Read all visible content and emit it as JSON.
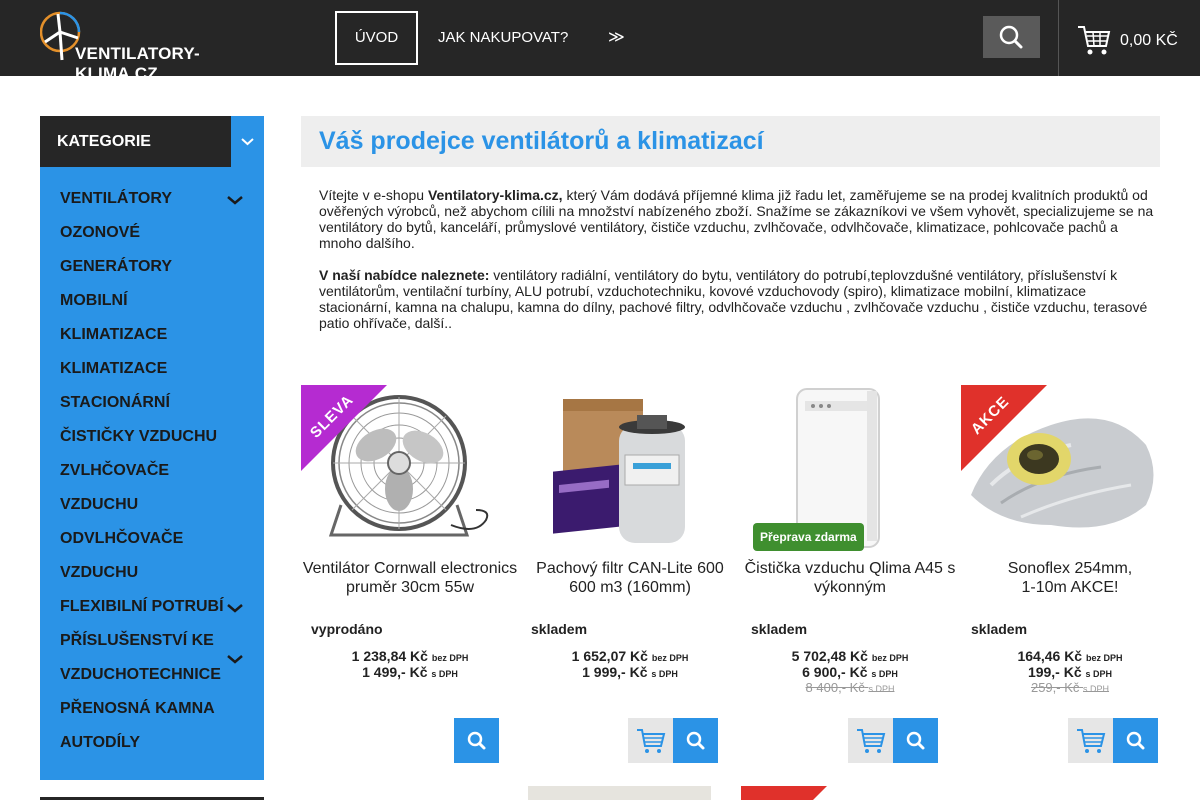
{
  "header": {
    "logo_text": "VENTILATORY-KLIMA.CZ",
    "nav": [
      "ÚVOD",
      "JAK NAKUPOVAT?",
      "≫"
    ],
    "cart_total": "0,00 KČ"
  },
  "sidebar": {
    "heading": "KATEGORIE",
    "items": [
      "VENTILÁTORY",
      "OZONOVÉ",
      "GENERÁTORY",
      "MOBILNÍ",
      "KLIMATIZACE",
      "KLIMATIZACE",
      "STACIONÁRNÍ",
      "ČISTIČKY VZDUCHU",
      "ZVLHČOVAČE",
      "VZDUCHU",
      "ODVLHČOVAČE",
      "VZDUCHU",
      "FLEXIBILNÍ POTRUBÍ",
      "PŘÍSLUŠENSTVÍ KE",
      "VZDUCHOTECHNICE",
      "PŘENOSNÁ KAMNA",
      "AUTODÍLY"
    ]
  },
  "main": {
    "title": "Váš prodejce ventilátorů a klimatizací",
    "intro_p1_pre": "Vítejte v e-shopu ",
    "intro_p1_bold": "Ventilatory-klima.cz,",
    "intro_p1_post": " který Vám dodává příjemné klima již řadu let, zaměřujeme se na prodej kvalitních produktů od ověřených výrobců, než abychom cílili na množství nabízeného zboží. Snažíme se zákazníkovi ve všem vyhovět, specializujeme se na ventilátory do bytů, kanceláří, průmyslové ventilátory, čističe vzduchu, zvlhčovače, odvlhčovače, klimatizace, pohlcovače pachů a mnoho dalšího.",
    "intro_p2_bold": "V naší nabídce naleznete:",
    "intro_p2_post": " ventilátory radiální, ventilátory do bytu, ventilátory do potrubí,teplovzdušné ventilátory, příslušenství k ventilátorům, ventilační turbíny, ALU potrubí, vzduchotechniku, kovové vzduchovody (spiro), klimatizace mobilní, klimatizace stacionární, kamna na chalupu, kamna do dílny, pachové filtry, odvlhčovače vzduchu , zvlhčovače vzduchu , čističe vzduchu, terasové patio ohřívače, další.."
  },
  "products": [
    {
      "name": "Ventilátor Cornwall electronics pruměr 30cm 55w",
      "stock": "vyprodáno",
      "price_ex": "1 238,84 Kč",
      "price_ex_note": "bez DPH",
      "price_inc": "1 499,- Kč",
      "price_inc_note": "s DPH",
      "ribbon": "SLEVA"
    },
    {
      "name": "Pachový filtr CAN-Lite 600 600 m3 (160mm)",
      "stock": "skladem",
      "price_ex": "1 652,07 Kč",
      "price_ex_note": "bez DPH",
      "price_inc": "1 999,- Kč",
      "price_inc_note": "s DPH"
    },
    {
      "name": "Čistička vzduchu Qlima A45 s výkonným",
      "stock": "skladem",
      "price_ex": "5 702,48 Kč",
      "price_ex_note": "bez DPH",
      "price_inc": "6 900,- Kč",
      "price_inc_note": "s DPH",
      "price_old": "8 400,- Kč",
      "price_old_note": "s DPH",
      "badge": "Přeprava zdarma"
    },
    {
      "name": "Sonoflex 254mm, 1-10m AKCE!",
      "stock": "skladem",
      "price_ex": "164,46 Kč",
      "price_ex_note": "bez DPH",
      "price_inc": "199,- Kč",
      "price_inc_note": "s DPH",
      "price_old": "259,- Kč",
      "price_old_note": "s DPH",
      "ribbon": "AKCE"
    }
  ],
  "colors": {
    "header_bg": "#262626",
    "accent_blue": "#2b93e6",
    "ribbon_red": "#e0312b",
    "ribbon_purple": "#b52bd1",
    "badge_green": "#3f8f2f"
  }
}
